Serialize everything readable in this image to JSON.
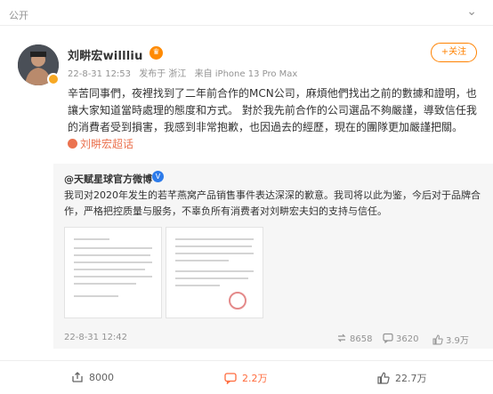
{
  "header": {
    "visibility": "公开",
    "more_icon": "chevron-down-icon"
  },
  "author": {
    "name": "刘畊宏willliu",
    "vip_badge": "vip-crown-icon",
    "verified_badge": "orange-v-icon"
  },
  "meta": {
    "time": "22-8-31 12:53",
    "location": "发布于 浙江",
    "source": "来自 iPhone 13 Pro Max"
  },
  "follow_label": "+关注",
  "post": {
    "text": "辛苦同事們，夜裡找到了二年前合作的MCN公司，麻煩他們找出之前的數據和證明，也讓大家知道當時處理的態度和方式。 對於我先前合作的公司選品不夠嚴謹，導致信任我的消費者受到損害，我感到非常抱歉，也因過去的經歷，現在的團隊更加嚴謹把關。",
    "topic": "刘畊宏超话"
  },
  "repost": {
    "author": "@天赋星球官方微博",
    "text": "我司对2020年发生的若芊燕窝产品销售事件表达深深的歉意。我司将以此为鉴，今后对于品牌合作，严格把控质量与服务，不辜负所有消费者对刘畊宏夫妇的支持与信任。",
    "time": "22-8-31 12:42",
    "reposts": "8658",
    "comments": "3620",
    "likes": "3.9万"
  },
  "actions": {
    "share": "8000",
    "comment": "2.2万",
    "like": "22.7万"
  },
  "colors": {
    "accent": "#ff8200",
    "link": "#eb7350",
    "verified": "#2d7bea",
    "muted": "#939393"
  }
}
